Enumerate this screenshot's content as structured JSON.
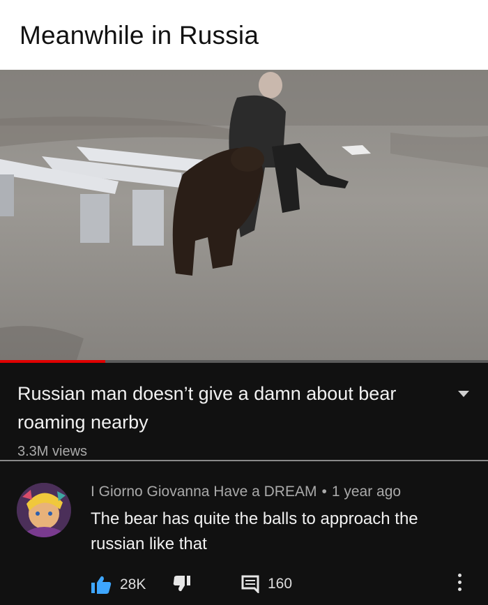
{
  "post": {
    "caption": "Meanwhile in Russia"
  },
  "video": {
    "progress": 0.215,
    "title": "Russian man doesn’t give a damn about bear roaming nearby",
    "views": "3.3M views"
  },
  "comment": {
    "author": "I Giorno Giovanna Have a DREAM",
    "separator": "•",
    "time": "1 year ago",
    "text": "The bear has quite the balls to approach the russian like that",
    "likes": "28K",
    "replies": "160"
  },
  "icons": {
    "like": "thumbs-up-icon",
    "dislike": "thumbs-down-icon",
    "reply": "comment-icon",
    "more": "more-vertical-icon",
    "expand": "chevron-down-icon"
  },
  "colors": {
    "like_blue": "#3ea6ff",
    "progress_red": "#e00000",
    "background_dark": "#111111"
  }
}
